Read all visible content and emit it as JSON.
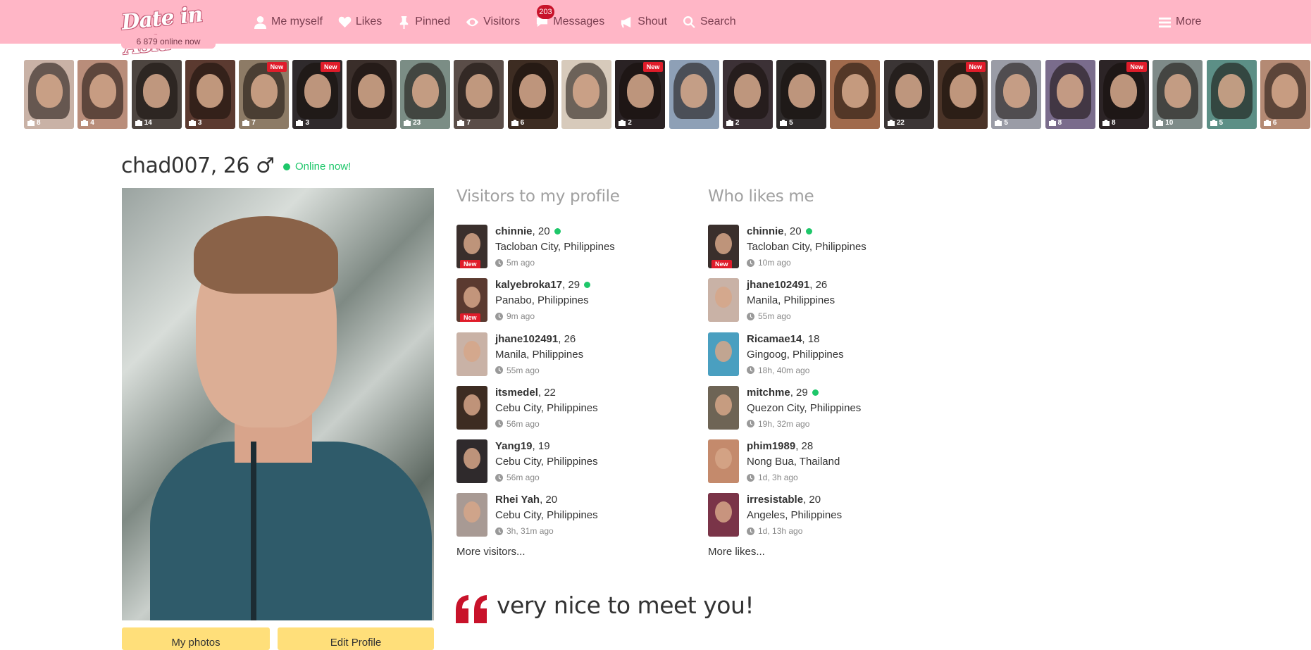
{
  "header": {
    "logo_text": "Date in Asia",
    "online_count": "6 879 online now",
    "nav": [
      {
        "label": "Me myself",
        "icon": "user-icon"
      },
      {
        "label": "Likes",
        "icon": "heart-icon"
      },
      {
        "label": "Pinned",
        "icon": "pin-icon"
      },
      {
        "label": "Visitors",
        "icon": "eye-icon"
      },
      {
        "label": "Messages",
        "icon": "chat-icon",
        "badge": "203"
      },
      {
        "label": "Shout",
        "icon": "megaphone-icon"
      },
      {
        "label": "Search",
        "icon": "search-icon"
      }
    ],
    "more_label": "More"
  },
  "strip": [
    {
      "count": "8",
      "new": false,
      "tone": "#c9b2a6"
    },
    {
      "count": "4",
      "new": false,
      "tone": "#b98d7a"
    },
    {
      "count": "14",
      "new": false,
      "tone": "#4d4540"
    },
    {
      "count": "3",
      "new": false,
      "tone": "#5b3a30"
    },
    {
      "count": "7",
      "new": true,
      "tone": "#8d7b66"
    },
    {
      "count": "3",
      "new": true,
      "tone": "#2f2a2c"
    },
    {
      "count": "",
      "new": false,
      "tone": "#3a2e2a"
    },
    {
      "count": "23",
      "new": false,
      "tone": "#7b8d85"
    },
    {
      "count": "7",
      "new": false,
      "tone": "#5a4d48"
    },
    {
      "count": "6",
      "new": false,
      "tone": "#3d2c22"
    },
    {
      "count": "",
      "new": false,
      "tone": "#d7cabb"
    },
    {
      "count": "2",
      "new": true,
      "tone": "#2a2224"
    },
    {
      "count": "",
      "new": false,
      "tone": "#8ea0b6"
    },
    {
      "count": "2",
      "new": false,
      "tone": "#3c3136"
    },
    {
      "count": "5",
      "new": false,
      "tone": "#2e2a2a"
    },
    {
      "count": "",
      "new": false,
      "tone": "#a06a4c"
    },
    {
      "count": "22",
      "new": false,
      "tone": "#3b3535"
    },
    {
      "count": "",
      "new": true,
      "tone": "#4a3327"
    },
    {
      "count": "5",
      "new": false,
      "tone": "#9a9ca6"
    },
    {
      "count": "8",
      "new": false,
      "tone": "#7a6c8c"
    },
    {
      "count": "8",
      "new": true,
      "tone": "#2c2426"
    },
    {
      "count": "10",
      "new": false,
      "tone": "#7e8a88"
    },
    {
      "count": "5",
      "new": false,
      "tone": "#5c8f86"
    },
    {
      "count": "6",
      "new": false,
      "tone": "#b48a74"
    }
  ],
  "profile": {
    "name_age": "chad007, 26 ♂",
    "status": "Online now!",
    "my_photos_label": "My photos",
    "edit_profile_label": "Edit Profile",
    "quote": "very nice to meet you!"
  },
  "visitors": {
    "title": "Visitors to my profile",
    "more": "More visitors...",
    "items": [
      {
        "name": "chinnie",
        "age": ", 20",
        "online": true,
        "location": "Tacloban City, Philippines",
        "ago": "5m ago",
        "new": true,
        "tone": "#3a2f2c"
      },
      {
        "name": "kalyebroka17",
        "age": ", 29",
        "online": true,
        "location": "Panabo, Philippines",
        "ago": "9m ago",
        "new": true,
        "tone": "#5b3a30"
      },
      {
        "name": "jhane102491",
        "age": ", 26",
        "online": false,
        "location": "Manila, Philippines",
        "ago": "55m ago",
        "new": false,
        "tone": "#c9b2a6"
      },
      {
        "name": "itsmedel",
        "age": ", 22",
        "online": false,
        "location": "Cebu City, Philippines",
        "ago": "56m ago",
        "new": false,
        "tone": "#3d2c22"
      },
      {
        "name": "Yang19",
        "age": ", 19",
        "online": false,
        "location": "Cebu City, Philippines",
        "ago": "56m ago",
        "new": false,
        "tone": "#2f2a2c"
      },
      {
        "name": "Rhei Yah",
        "age": ", 20",
        "online": false,
        "location": "Cebu City, Philippines",
        "ago": "3h, 31m ago",
        "new": false,
        "tone": "#a89a94"
      }
    ]
  },
  "likes": {
    "title": "Who likes me",
    "more": "More likes...",
    "items": [
      {
        "name": "chinnie",
        "age": ", 20",
        "online": true,
        "location": "Tacloban City, Philippines",
        "ago": "10m ago",
        "new": true,
        "tone": "#3a2f2c"
      },
      {
        "name": "jhane102491",
        "age": ", 26",
        "online": false,
        "location": "Manila, Philippines",
        "ago": "55m ago",
        "new": false,
        "tone": "#c9b2a6"
      },
      {
        "name": "Ricamae14",
        "age": ", 18",
        "online": false,
        "location": "Gingoog, Philippines",
        "ago": "18h, 40m ago",
        "new": false,
        "tone": "#4a9fc0"
      },
      {
        "name": "mitchme",
        "age": ", 29",
        "online": true,
        "location": "Quezon City, Philippines",
        "ago": "19h, 32m ago",
        "new": false,
        "tone": "#6e6455"
      },
      {
        "name": "phim1989",
        "age": ", 28",
        "online": false,
        "location": "Nong Bua, Thailand",
        "ago": "1d, 3h ago",
        "new": false,
        "tone": "#c48a6c"
      },
      {
        "name": "irresistable",
        "age": ", 20",
        "online": false,
        "location": "Angeles, Philippines",
        "ago": "1d, 13h ago",
        "new": false,
        "tone": "#7a3448"
      }
    ]
  },
  "new_label": "New",
  "colors": {
    "nav_bg": "#ffb6c6",
    "online": "#1ec76a",
    "new_badge": "#e01c2a",
    "button": "#ffdf7a",
    "quote_mark": "#c8122a"
  }
}
